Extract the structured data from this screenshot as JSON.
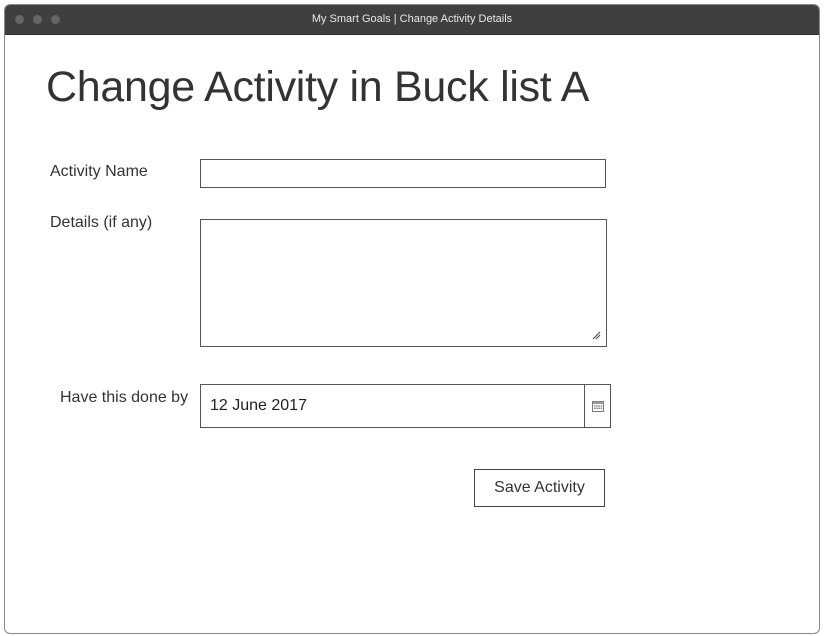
{
  "window": {
    "title": "My Smart Goals | Change Activity Details"
  },
  "page": {
    "heading": "Change Activity in Buck list A"
  },
  "form": {
    "activity_name": {
      "label": "Activity Name",
      "value": ""
    },
    "details": {
      "label": "Details (if any)",
      "value": ""
    },
    "due_date": {
      "label": "Have this done by",
      "value": "12 June 2017",
      "icon": "calendar-icon"
    },
    "save_label": "Save Activity"
  },
  "colors": {
    "titlebar": "#3f3f3f",
    "text": "#333333",
    "border": "#555555"
  }
}
